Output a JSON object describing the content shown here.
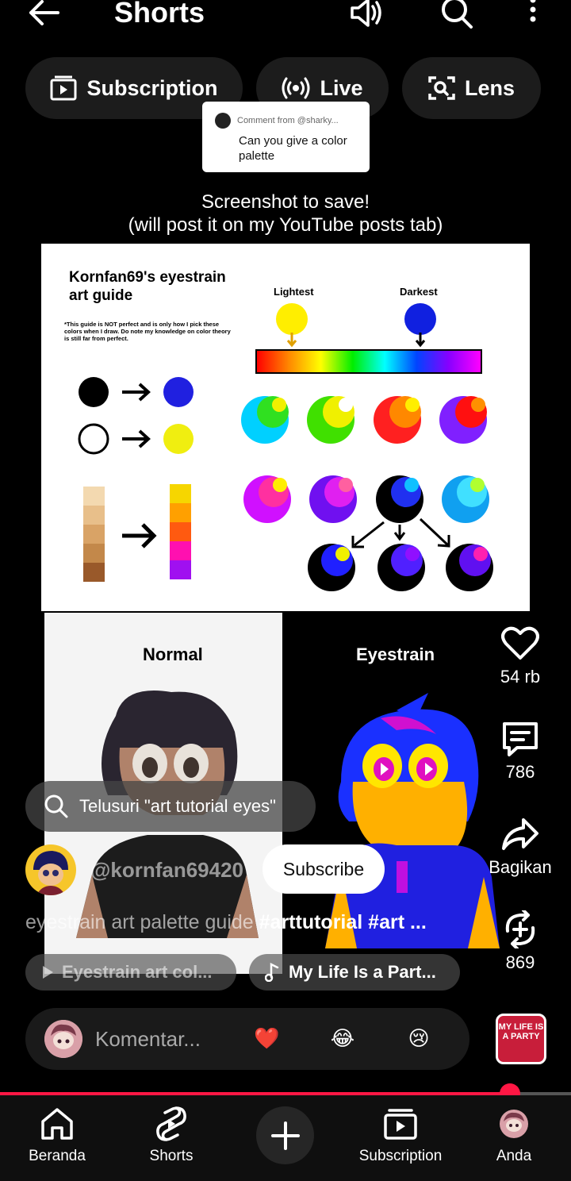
{
  "header": {
    "title": "Shorts"
  },
  "chips": [
    {
      "label": "Subscription",
      "icon": "subscriptions-icon"
    },
    {
      "label": "Live",
      "icon": "live-icon"
    },
    {
      "label": "Lens",
      "icon": "lens-icon"
    }
  ],
  "comment": {
    "from": "Comment from @sharky...",
    "text": "Can you give a color palette"
  },
  "caption": {
    "line1": "Screenshot to save!",
    "line2": "(will post it on my YouTube posts tab)"
  },
  "guide": {
    "title": "Kornfan69's eyestrain art guide",
    "note": "*This guide is NOT perfect and is only how I pick these colors when I draw. Do note my knowledge on color theory is still far from perfect.",
    "lightest": "Lightest",
    "darkest": "Darkest"
  },
  "panels": {
    "normal": "Normal",
    "eyestrain": "Eyestrain"
  },
  "actions": {
    "likes": "54 rb",
    "comments": "786",
    "share": "Bagikan",
    "remix": "869"
  },
  "search": {
    "text": "Telusuri \"art tutorial eyes\""
  },
  "channel": {
    "name": "@kornfan69420",
    "subscribe": "Subscribe"
  },
  "description": {
    "plain": "eyestrain art palette guide ",
    "tags": "#arttutorial #art ..."
  },
  "pills": {
    "video": "Eyestrain art col...",
    "music": "My Life Is a Part..."
  },
  "comment_input": {
    "placeholder": "Komentar...",
    "emojis": [
      "❤️",
      "😂",
      "😢"
    ]
  },
  "music_thumb": {
    "text": "MY LIFE IS A PARTY"
  },
  "progress": {
    "fraction": 0.893
  },
  "bottom_nav": [
    {
      "label": "Beranda",
      "icon": "home-icon"
    },
    {
      "label": "Shorts",
      "icon": "shorts-icon"
    },
    {
      "label": "Subscription",
      "icon": "subscriptions-icon"
    },
    {
      "label": "Anda",
      "icon": "profile-avatar-icon"
    }
  ],
  "colors": {
    "accent": "#ff1744",
    "chip_bg": "#1c1c1c"
  }
}
